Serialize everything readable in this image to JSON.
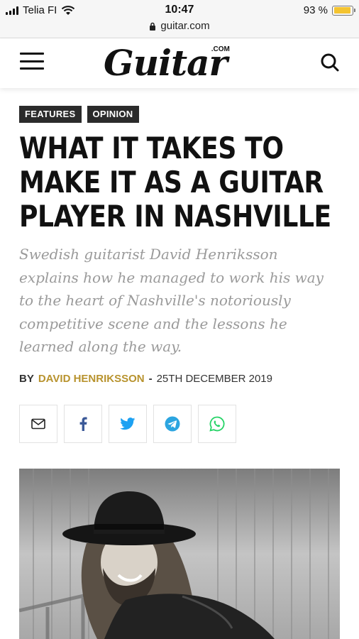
{
  "status_bar": {
    "carrier": "Telia FI",
    "time": "10:47",
    "url": "guitar.com",
    "battery": "93 %",
    "battery_level": 0.93
  },
  "header": {
    "logo_text": "Guitar",
    "logo_suffix": ".COM"
  },
  "article": {
    "tags": [
      "FEATURES",
      "OPINION"
    ],
    "headline": "WHAT IT TAKES TO MAKE IT AS A GUITAR PLAYER IN NASHVILLE",
    "standfirst": "Swedish guitarist David Henriksson explains how he managed to work his way to the heart of Nashville's notoriously competitive scene and the lessons he learned along the way.",
    "byline_prefix": "BY",
    "author": "DAVID HENRIKSSON",
    "separator": "-",
    "date": "25TH DECEMBER 2019"
  },
  "share": [
    {
      "name": "email",
      "icon": "envelope-icon",
      "color": "#222222"
    },
    {
      "name": "facebook",
      "icon": "facebook-icon",
      "color": "#3b5998"
    },
    {
      "name": "twitter",
      "icon": "twitter-icon",
      "color": "#1da1f2"
    },
    {
      "name": "telegram",
      "icon": "telegram-icon",
      "color": "#2ca5e0"
    },
    {
      "name": "whatsapp",
      "icon": "whatsapp-icon",
      "color": "#25d366"
    }
  ],
  "colors": {
    "author": "#b8932e",
    "tag_bg": "#2b2b2b",
    "standfirst": "#9a9a9a"
  }
}
